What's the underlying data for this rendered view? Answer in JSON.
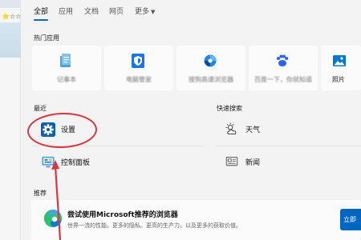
{
  "background_app": {
    "star_text": "⭐",
    "row_text": "☆☆☆"
  },
  "tabs": [
    {
      "label": "全部",
      "active": true
    },
    {
      "label": "应用"
    },
    {
      "label": "文档"
    },
    {
      "label": "网页"
    },
    {
      "label": "更多"
    }
  ],
  "hot_apps": {
    "title": "热门应用",
    "items": [
      {
        "label": "记事本",
        "icon": "notepad-icon"
      },
      {
        "label": "电脑管家",
        "icon": "shield-icon"
      },
      {
        "label": "搜狗高速浏览器",
        "icon": "browser-icon"
      },
      {
        "label": "百度一下，你就知道",
        "icon": "paw-icon"
      },
      {
        "label": "照片",
        "icon": "photos-icon"
      }
    ]
  },
  "recent": {
    "title": "最近",
    "items": [
      {
        "label": "设置",
        "icon": "gear-icon"
      },
      {
        "label": "控制面板",
        "icon": "control-panel-icon"
      }
    ]
  },
  "quick_search": {
    "title": "快速搜索",
    "items": [
      {
        "label": "天气",
        "icon": "weather-icon"
      },
      {
        "label": "新闻",
        "icon": "news-icon"
      }
    ]
  },
  "recommend": {
    "title": "推荐",
    "card_title": "尝试使用Microsoft推荐的浏览器",
    "card_desc": "世界一流的性能。更多的隐私。更高的生产力。以及更多的获取价值。",
    "button_label": "立即"
  },
  "colors": {
    "accent": "#0067c0",
    "annotation": "#d9363e"
  }
}
